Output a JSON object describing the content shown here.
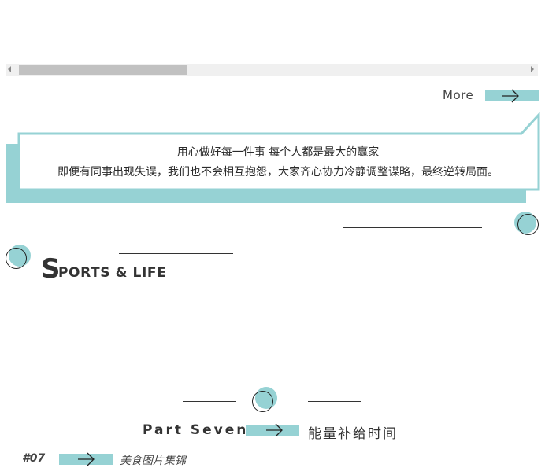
{
  "colors": {
    "accent": "#96d2d4",
    "text": "#333333",
    "scrollbar_thumb": "#c1c1c1",
    "scrollbar_track": "#f0f0f0"
  },
  "more": {
    "label": "More",
    "icon": "arrow-right-icon"
  },
  "callout": {
    "line1": "用心做好每一件事 每个人都是最大的赢家",
    "line2": "即便有同事出现失误，我们也不会相互抱怨，大家齐心协力冷静调整谋略，最终逆转局面。"
  },
  "sports": {
    "big_letter": "S",
    "rest": "PORTS & LIFE"
  },
  "part": {
    "label": "Part Seven",
    "title": "能量补给时间",
    "icon": "arrow-right-icon"
  },
  "footer": {
    "number": "#07",
    "title": "美食图片集锦",
    "icon": "arrow-right-icon"
  }
}
